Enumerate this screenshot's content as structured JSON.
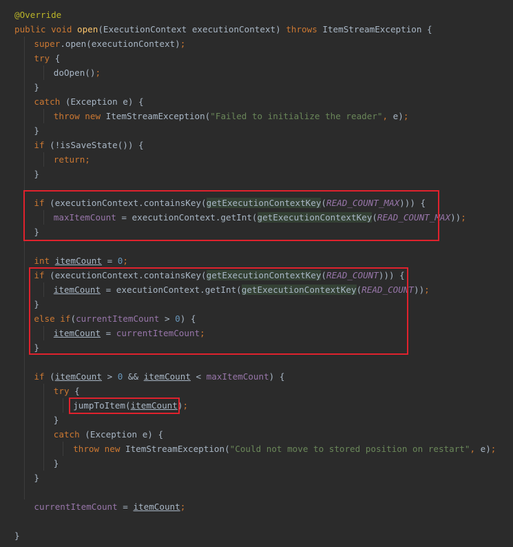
{
  "code": {
    "annotation": "@Override",
    "lines": [
      {
        "indent": 0,
        "tokens": [
          [
            "an",
            "@Override"
          ]
        ]
      },
      {
        "indent": 0,
        "tokens": [
          [
            "kw",
            "public void "
          ],
          [
            "fn",
            "open"
          ],
          [
            "p",
            "(ExecutionContext executionContext) "
          ],
          [
            "kw",
            "throws "
          ],
          [
            "p",
            "ItemStreamException {"
          ]
        ]
      },
      {
        "indent": 1,
        "tokens": [
          [
            "kw",
            "super"
          ],
          [
            "p",
            ".open(executionContext)"
          ],
          [
            "kw",
            ";"
          ]
        ]
      },
      {
        "indent": 1,
        "tokens": [
          [
            "kw",
            "try "
          ],
          [
            "p",
            "{"
          ]
        ]
      },
      {
        "indent": 2,
        "tokens": [
          [
            "p",
            "doOpen()"
          ],
          [
            "kw",
            ";"
          ]
        ]
      },
      {
        "indent": 1,
        "tokens": [
          [
            "p",
            "}"
          ]
        ]
      },
      {
        "indent": 1,
        "tokens": [
          [
            "kw",
            "catch "
          ],
          [
            "p",
            "(Exception e) {"
          ]
        ]
      },
      {
        "indent": 2,
        "tokens": [
          [
            "kw",
            "throw new "
          ],
          [
            "p",
            "ItemStreamException("
          ],
          [
            "str",
            "\"Failed to initialize the reader\""
          ],
          [
            "kw",
            ", "
          ],
          [
            "p",
            "e)"
          ],
          [
            "kw",
            ";"
          ]
        ]
      },
      {
        "indent": 1,
        "tokens": [
          [
            "p",
            "}"
          ]
        ]
      },
      {
        "indent": 1,
        "tokens": [
          [
            "kw",
            "if "
          ],
          [
            "p",
            "(!isSaveState()) {"
          ]
        ]
      },
      {
        "indent": 2,
        "tokens": [
          [
            "kw",
            "return;"
          ]
        ]
      },
      {
        "indent": 1,
        "tokens": [
          [
            "p",
            "}"
          ]
        ]
      },
      {
        "indent": 0,
        "tokens": []
      },
      {
        "indent": 1,
        "tokens": [
          [
            "kw",
            "if "
          ],
          [
            "p",
            "(executionContext.containsKey("
          ],
          [
            "hl",
            "getExecutionContextKey"
          ],
          [
            "p",
            "("
          ],
          [
            "cst",
            "READ_COUNT_MAX"
          ],
          [
            "p",
            ")))"
          ],
          [
            "p",
            " {"
          ]
        ]
      },
      {
        "indent": 2,
        "tokens": [
          [
            "fld",
            "maxItemCount "
          ],
          [
            "p",
            "= executionContext.getInt("
          ],
          [
            "hl",
            "getExecutionContextKey"
          ],
          [
            "p",
            "("
          ],
          [
            "cst",
            "READ_COUNT_MAX"
          ],
          [
            "p",
            "))"
          ],
          [
            "kw",
            ";"
          ]
        ]
      },
      {
        "indent": 1,
        "tokens": [
          [
            "p",
            "}"
          ]
        ]
      },
      {
        "indent": 0,
        "tokens": []
      },
      {
        "indent": 1,
        "tokens": [
          [
            "kw",
            "int "
          ],
          [
            "ul",
            "itemCount"
          ],
          [
            "p",
            " = "
          ],
          [
            "num",
            "0"
          ],
          [
            "kw",
            ";"
          ]
        ]
      },
      {
        "indent": 1,
        "tokens": [
          [
            "kw",
            "if "
          ],
          [
            "p",
            "(executionContext.containsKey("
          ],
          [
            "hl",
            "getExecutionContextKey"
          ],
          [
            "p",
            "("
          ],
          [
            "cst",
            "READ_COUNT"
          ],
          [
            "p",
            ")))"
          ],
          [
            "p",
            " {"
          ]
        ]
      },
      {
        "indent": 2,
        "tokens": [
          [
            "ul",
            "itemCount"
          ],
          [
            "p",
            " = executionContext.getInt("
          ],
          [
            "hl",
            "getExecutionContextKey"
          ],
          [
            "p",
            "("
          ],
          [
            "cst",
            "READ_COUNT"
          ],
          [
            "p",
            "))"
          ],
          [
            "kw",
            ";"
          ]
        ]
      },
      {
        "indent": 1,
        "tokens": [
          [
            "p",
            "}"
          ]
        ]
      },
      {
        "indent": 1,
        "tokens": [
          [
            "kw",
            "else if"
          ],
          [
            "p",
            "("
          ],
          [
            "fld",
            "currentItemCount"
          ],
          [
            "p",
            " > "
          ],
          [
            "num",
            "0"
          ],
          [
            "p",
            ") {"
          ]
        ]
      },
      {
        "indent": 2,
        "tokens": [
          [
            "ul",
            "itemCount"
          ],
          [
            "p",
            " = "
          ],
          [
            "fld",
            "currentItemCount"
          ],
          [
            "kw",
            ";"
          ]
        ]
      },
      {
        "indent": 1,
        "tokens": [
          [
            "p",
            "}"
          ]
        ]
      },
      {
        "indent": 0,
        "tokens": []
      },
      {
        "indent": 1,
        "tokens": [
          [
            "kw",
            "if "
          ],
          [
            "p",
            "("
          ],
          [
            "ul",
            "itemCount"
          ],
          [
            "p",
            " > "
          ],
          [
            "num",
            "0"
          ],
          [
            "p",
            " && "
          ],
          [
            "ul",
            "itemCount"
          ],
          [
            "p",
            " < "
          ],
          [
            "fld",
            "maxItemCount"
          ],
          [
            "p",
            ") {"
          ]
        ]
      },
      {
        "indent": 2,
        "tokens": [
          [
            "kw",
            "try "
          ],
          [
            "p",
            "{"
          ]
        ]
      },
      {
        "indent": 3,
        "tokens": [
          [
            "p",
            "jumpToItem("
          ],
          [
            "ul",
            "itemCount"
          ],
          [
            "p",
            ")"
          ],
          [
            "kw",
            ";"
          ]
        ]
      },
      {
        "indent": 2,
        "tokens": [
          [
            "p",
            "}"
          ]
        ]
      },
      {
        "indent": 2,
        "tokens": [
          [
            "kw",
            "catch "
          ],
          [
            "p",
            "(Exception e) {"
          ]
        ]
      },
      {
        "indent": 3,
        "tokens": [
          [
            "kw",
            "throw new "
          ],
          [
            "p",
            "ItemStreamException("
          ],
          [
            "str",
            "\"Could not move to stored position on restart\""
          ],
          [
            "kw",
            ", "
          ],
          [
            "p",
            "e)"
          ],
          [
            "kw",
            ";"
          ]
        ]
      },
      {
        "indent": 2,
        "tokens": [
          [
            "p",
            "}"
          ]
        ]
      },
      {
        "indent": 1,
        "tokens": [
          [
            "p",
            "}"
          ]
        ]
      },
      {
        "indent": 0,
        "tokens": []
      },
      {
        "indent": 1,
        "tokens": [
          [
            "fld",
            "currentItemCount"
          ],
          [
            "p",
            " = "
          ],
          [
            "ul",
            "itemCount"
          ],
          [
            "kw",
            ";"
          ]
        ]
      },
      {
        "indent": 0,
        "tokens": []
      },
      {
        "indent": 0,
        "tokens": [
          [
            "p",
            "}"
          ]
        ]
      }
    ]
  },
  "colors": {
    "background": "#2b2b2b",
    "keyword": "#cc7832",
    "annotation": "#bbb529",
    "method_decl": "#ffc66d",
    "field": "#9876aa",
    "string": "#6a8759",
    "number": "#6897bb",
    "plain": "#a9b7c6",
    "highlight_box": "#e0222d"
  }
}
